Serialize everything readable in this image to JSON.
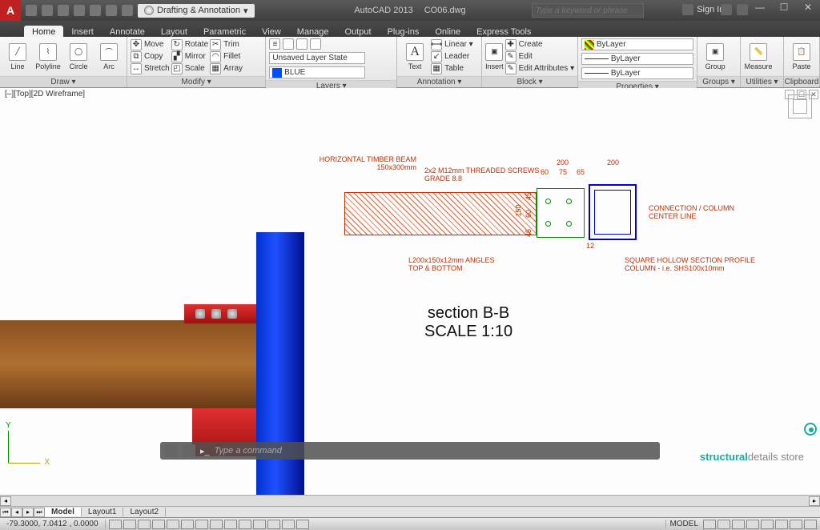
{
  "app": {
    "name": "AutoCAD 2013",
    "file": "CO06.dwg"
  },
  "workspace": "Drafting & Annotation",
  "search_placeholder": "Type a keyword or phrase",
  "signin": "Sign In",
  "win": {
    "min": "—",
    "max": "☐",
    "close": "✕"
  },
  "tabs": [
    "Home",
    "Insert",
    "Annotate",
    "Layout",
    "Parametric",
    "View",
    "Manage",
    "Output",
    "Plug-ins",
    "Online",
    "Express Tools"
  ],
  "active_tab": 0,
  "panels": {
    "draw": {
      "title": "Draw ▾",
      "items": [
        "Line",
        "Polyline",
        "Circle",
        "Arc"
      ]
    },
    "modify": {
      "title": "Modify ▾",
      "col1": [
        "Move",
        "Copy",
        "Stretch"
      ],
      "col2": [
        "Rotate",
        "Mirror",
        "Scale"
      ],
      "col3": [
        "Trim",
        "Fillet",
        "Array"
      ]
    },
    "layers": {
      "title": "Layers ▾",
      "state": "Unsaved Layer State",
      "current": "BLUE"
    },
    "annotation": {
      "title": "Annotation ▾",
      "text": "Text",
      "items": [
        "Linear ▾",
        "Leader",
        "Table"
      ]
    },
    "block": {
      "title": "Block ▾",
      "insert": "Insert",
      "items": [
        "Create",
        "Edit",
        "Edit Attributes ▾"
      ]
    },
    "properties": {
      "title": "Properties ▾",
      "color": "ByLayer",
      "ltype": "ByLayer",
      "lweight": "ByLayer"
    },
    "groups": {
      "title": "Groups ▾",
      "item": "Group"
    },
    "utilities": {
      "title": "Utilities ▾",
      "item": "Measure"
    },
    "clipboard": {
      "title": "Clipboard",
      "item": "Paste"
    }
  },
  "view_label": "[–][Top][2D Wireframe]",
  "cmd_placeholder": "Type a command",
  "layout_tabs": [
    "Model",
    "Layout1",
    "Layout2"
  ],
  "active_layout": 0,
  "status": {
    "coords": "-79.3000, 7.0412 , 0.0000",
    "model": "MODEL"
  },
  "drawing": {
    "labels": {
      "beam": "HORIZONTAL TIMBER BEAM",
      "beam_size": "150x300mm",
      "screws1": "2x2 M12mm THREADED SCREWS",
      "screws2": "GRADE 8.8",
      "angles1": "L200x150x12mm ANGLES",
      "angles2": "TOP & BOTTOM",
      "conn1": "CONNECTION / COLUMN",
      "conn2": "CENTER LINE",
      "col1": "SQUARE HOLLOW SECTION PROFILE",
      "col2": "COLUMN - i.e. SHS100x10mm"
    },
    "dims": {
      "d150": "150",
      "d200a": "200",
      "d200b": "200",
      "d60": "60",
      "d75": "75",
      "d65": "65",
      "d12": "12",
      "d45a": "45",
      "d60b": "60",
      "d45b": "45"
    },
    "section_title": "section B-B",
    "section_scale": "SCALE 1:10",
    "brand_a": "structural",
    "brand_b": "details ",
    "brand_c": "store"
  }
}
